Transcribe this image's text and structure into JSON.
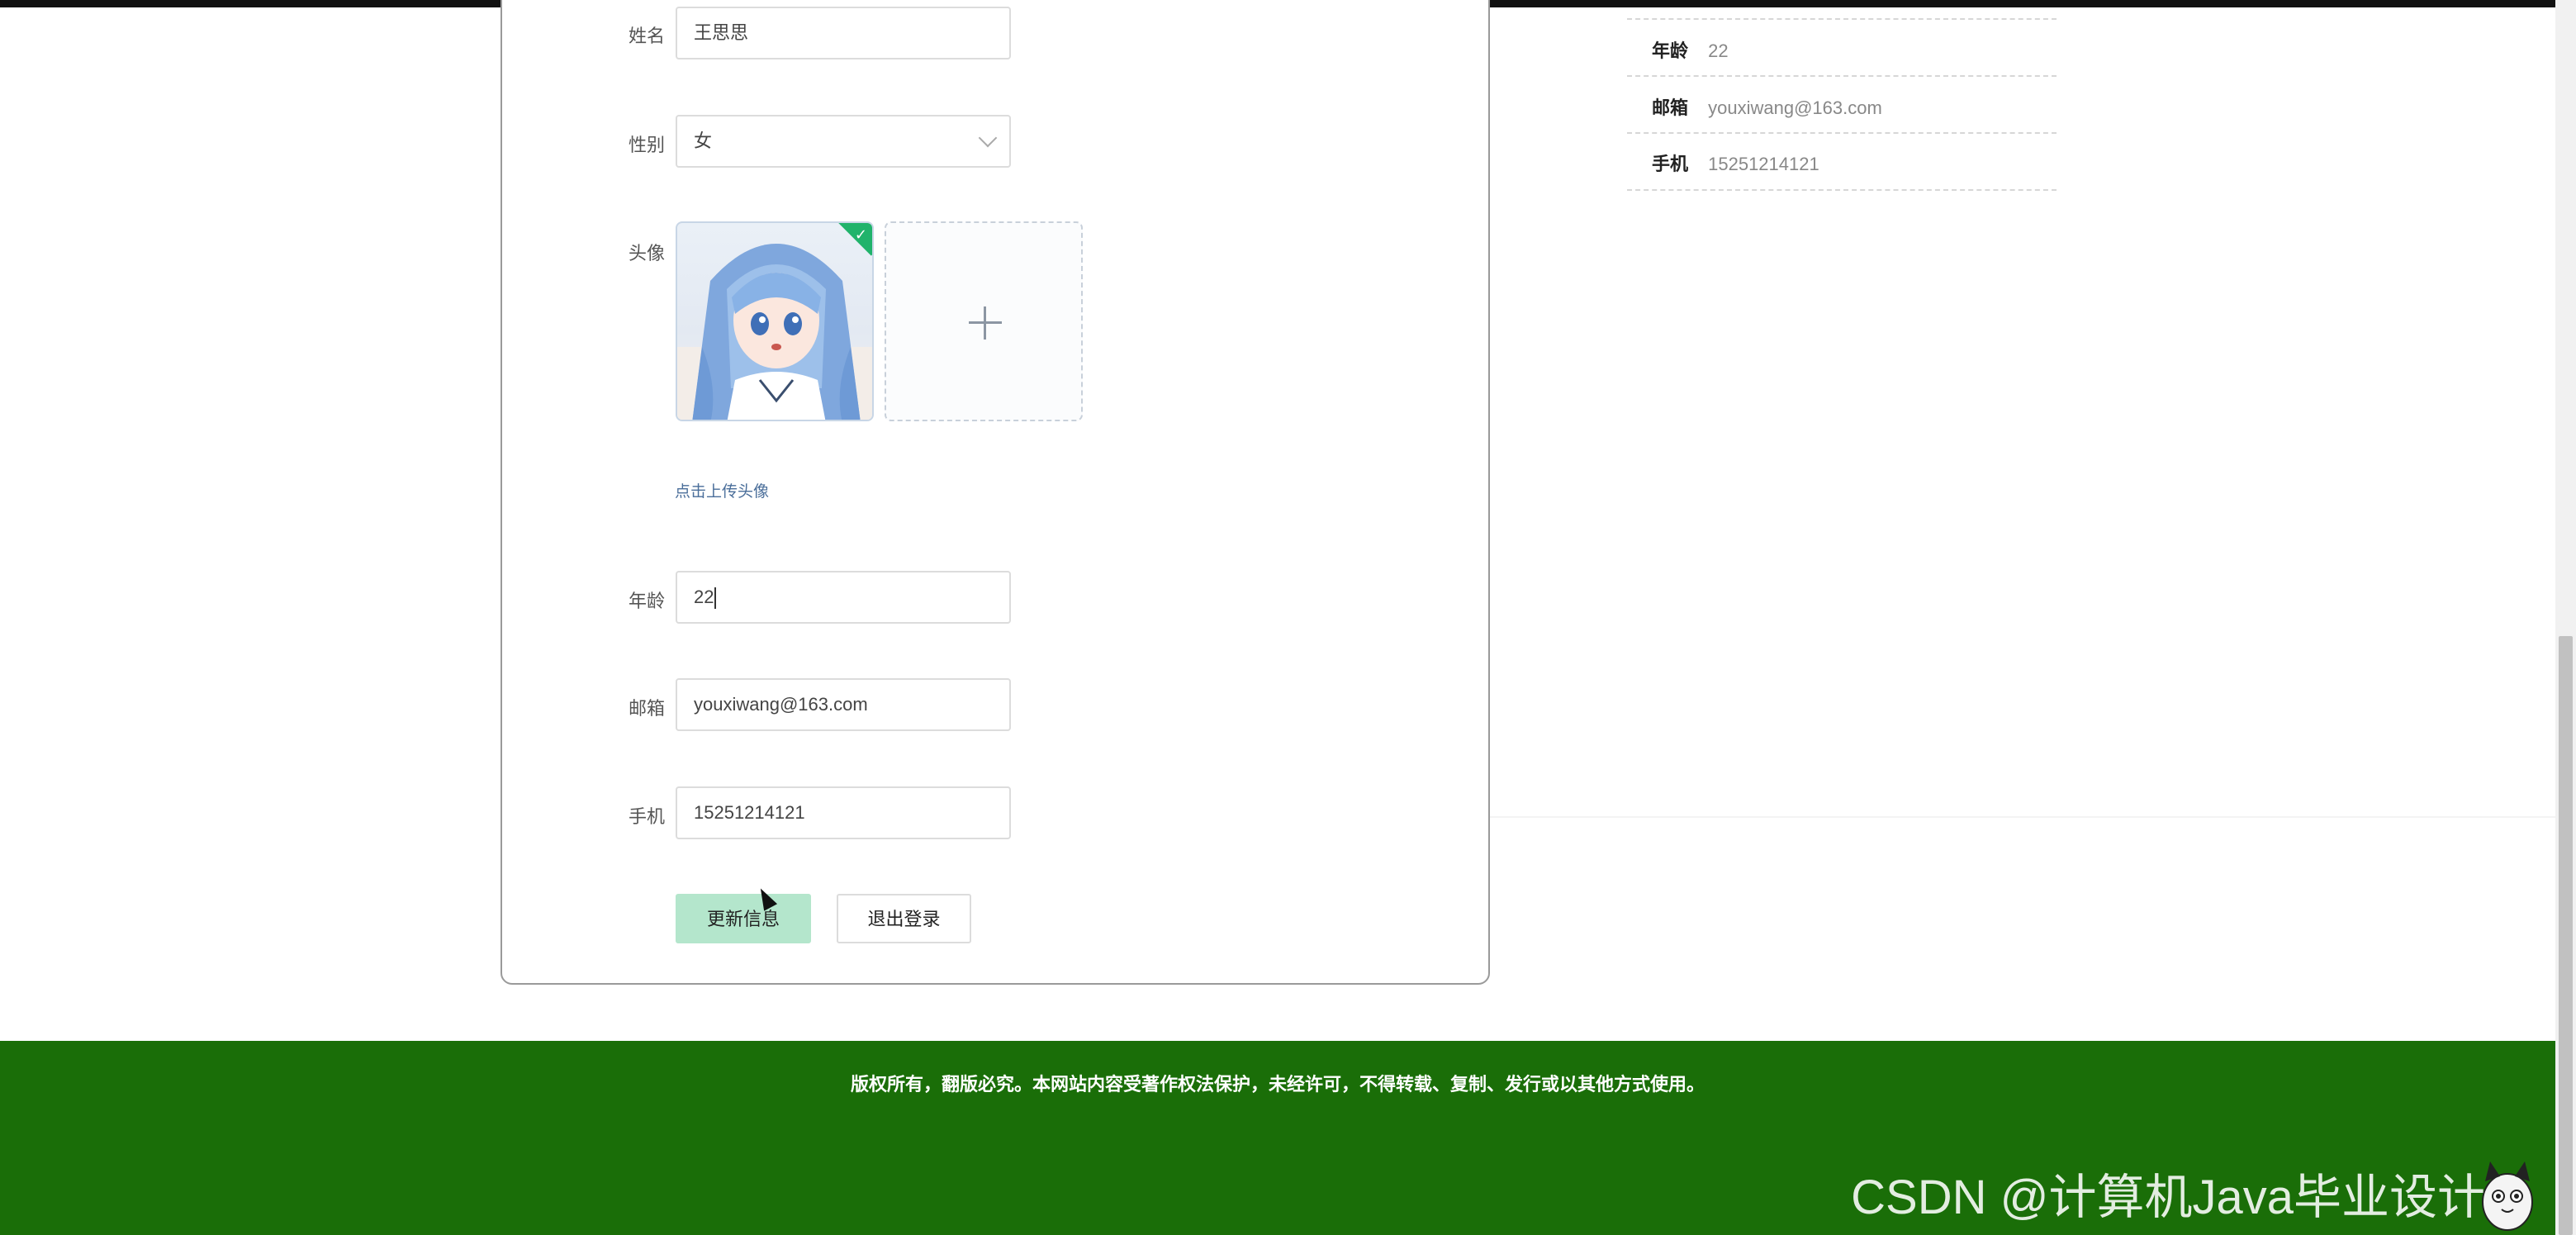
{
  "form": {
    "name": {
      "label": "姓名",
      "value": "王思思"
    },
    "gender": {
      "label": "性别",
      "value": "女"
    },
    "avatar": {
      "label": "头像",
      "hint": "点击上传头像"
    },
    "age": {
      "label": "年龄",
      "value": "22"
    },
    "email": {
      "label": "邮箱",
      "value": "youxiwang@163.com"
    },
    "phone": {
      "label": "手机",
      "value": "15251214121"
    },
    "update_button": "更新信息",
    "logout_button": "退出登录"
  },
  "info_panel": {
    "rows": [
      {
        "key": "年龄",
        "value": "22"
      },
      {
        "key": "邮箱",
        "value": "youxiwang@163.com"
      },
      {
        "key": "手机",
        "value": "15251214121"
      }
    ]
  },
  "footer": {
    "copyright": "版权所有，翻版必究。本网站内容受著作权法保护，未经许可，不得转载、复制、发行或以其他方式使用。",
    "watermark": "CSDN @计算机Java毕业设计"
  },
  "colors": {
    "footer_bg": "#1a6e08",
    "update_btn": "#b4e6cc",
    "upload_check": "#20b36b"
  },
  "icons": [
    "chevron-down-icon",
    "check-icon",
    "plus-icon",
    "mouse-cursor-icon",
    "mascot-icon"
  ]
}
